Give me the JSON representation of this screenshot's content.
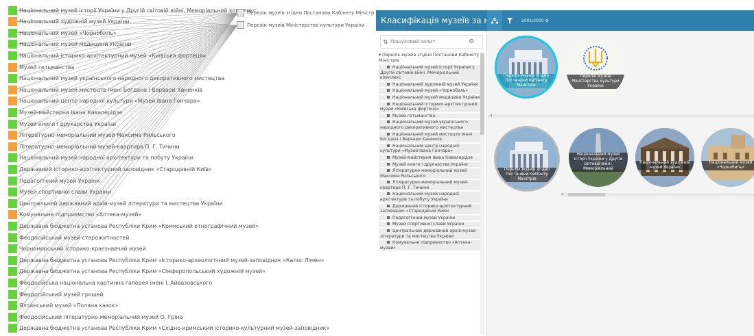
{
  "graph": {
    "root_nodes": [
      "Перелік музеїв згідно Постанови Кабінету Міністрів",
      "Перелік музеїв Міністерства культури України"
    ],
    "museums": [
      {
        "label": "Національний музей історії України у Другій світовій війні. Меморіальний комплекс",
        "color": "green"
      },
      {
        "label": "Національний художній музей України",
        "color": "orange"
      },
      {
        "label": "Національний музей «Чорнобиль»",
        "color": "green"
      },
      {
        "label": "Національний музей медицини України",
        "color": "green"
      },
      {
        "label": "Національний історико-архітектурний музей «Київська фортеця»",
        "color": "green"
      },
      {
        "label": "Музей гетьманства",
        "color": "orange"
      },
      {
        "label": "Національний музей українського народного декоративного мистецтва",
        "color": "green"
      },
      {
        "label": "Національний музей мистецтв імені Богдана і Варвари Ханенків",
        "color": "orange"
      },
      {
        "label": "Національний центр народної культури «Музей Івана Гончара»",
        "color": "orange"
      },
      {
        "label": "Музей-майстерня Івана Кавалерідзе",
        "color": "green"
      },
      {
        "label": "Музей книги і друкарства України",
        "color": "green"
      },
      {
        "label": "Літературно-меморіальний музей Максима Рильського",
        "color": "orange"
      },
      {
        "label": "Літературно-меморіальний музей-квартира П. Г. Тичини",
        "color": "orange"
      },
      {
        "label": "Національний музей народної архітектури та побуту України",
        "color": "green"
      },
      {
        "label": "Державний історико-архітектурний заповідник «Стародавній Київ»",
        "color": "green"
      },
      {
        "label": "Педагогічний музей України",
        "color": "green"
      },
      {
        "label": "Музей спортивної слави України",
        "color": "green"
      },
      {
        "label": "Центральний державний архів-музей літератури та мистецтва України",
        "color": "green"
      },
      {
        "label": "Комунальне підприємство «Аптека-музей»",
        "color": "orange"
      },
      {
        "label": "Державна бюджетна установа Республіки Крим «Кримський етнографічний музей»",
        "color": "green"
      },
      {
        "label": "Феодосійський музей старожитностей",
        "color": "green"
      },
      {
        "label": "Чорноморський історико-краєзнавчий музей",
        "color": "green"
      },
      {
        "label": "Державна бюджетна установа Республіки Крим «Історико-археологічний музей-заповідник «Калос Лімен»",
        "color": "green"
      },
      {
        "label": "Державна бюджетна установа Республіки Крим «Сімферопольський художній музей»",
        "color": "green"
      },
      {
        "label": "Феодосійська національна картинна галерея імені І. Айвазовського",
        "color": "green"
      },
      {
        "label": "Феодосійський музей грошей",
        "color": "green"
      },
      {
        "label": "Ялтинський музей «Поляна казок»",
        "color": "green"
      },
      {
        "label": "Феодосійський літературно-меморіальний музей О. Гріна",
        "color": "green"
      },
      {
        "label": "Державна бюджетна установа Республіки Крим «Східно-кримський історико-культурний музей-заповідник»",
        "color": "green"
      }
    ]
  },
  "app": {
    "title": "Класифікація музеїв за но...",
    "toolbar": {
      "tree_icon": "sitemap-icon",
      "filter_icon": "filter-icon",
      "year_label": "2001/2000 ⚙"
    },
    "search": {
      "placeholder": "Пошуковий запит"
    },
    "tree": {
      "parent": "Перелік музеїв згідно Постанови Кабінету Міністрів",
      "items": [
        "Національний музей історії України у Другій світовій війні. Меморіальний комплекс",
        "Національний художній музей України",
        "Національний музей «Чорнобиль»",
        "Національний музей медицини України",
        "Національний історико-архітектурний музей «Київська фортеця»",
        "Музей гетьманства",
        "Національний музей українського народного декоративного мистецтва",
        "Національний музей мистецтв імені Богдана і Варвари Ханенків",
        "Національний центр народної культури «Музей Івана Гончара»",
        "Музей-майстерня Івана Кавалерідзе",
        "Музей книги і друкарства України",
        "Літературно-меморіальний музей Максима Рильського",
        "Літературно-меморіальний музей-квартира П. Г. Тичини",
        "Національний музей народної архітектури та побуту України",
        "Державний історико-архітектурний заповідник «Стародавній Київ»",
        "Педагогічний музей України",
        "Музей спортивної слави України",
        "Центральний державний архів-музей літератури та мистецтва України",
        "Комунальне підприємство «Аптека-музей»"
      ]
    },
    "cards_top": [
      {
        "caption": "Перелік музеїв згідно Постанови Кабінету Міністрів",
        "selected": true
      },
      {
        "caption": "Перелік музеїв Міністерства культури України",
        "selected": false
      }
    ],
    "cards_bottom": [
      {
        "caption": "Перелік музеїв згідно Постанови Кабінету Міністрів"
      },
      {
        "caption": "Національний музей історії України у Другій світовій війні. Меморіальний"
      },
      {
        "caption": "Національний художній музей України"
      },
      {
        "caption": "Національний музей «Чорнобиль»"
      }
    ],
    "colors": {
      "topbar": "#2f80ad",
      "node_green": "#67d33b",
      "node_orange": "#f5a03a",
      "selected_ring": "#19c9e0"
    }
  }
}
